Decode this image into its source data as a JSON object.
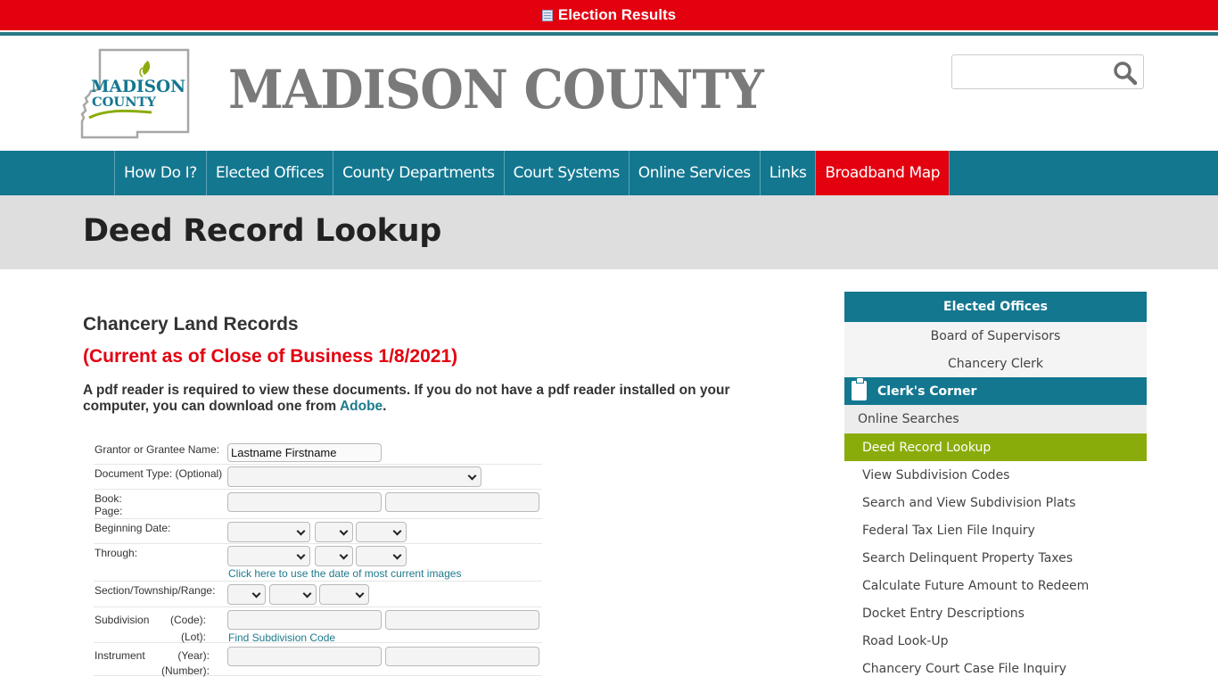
{
  "alert": {
    "label": "Election Results",
    "icon": "calendar-table-icon"
  },
  "header": {
    "logo_text_line1": "MADISON",
    "logo_text_line2": "COUNTY",
    "site_title": "MADISON COUNTY",
    "search_placeholder": "",
    "search_icon": "search-icon"
  },
  "nav": {
    "items": [
      {
        "label": "How Do I?"
      },
      {
        "label": "Elected Offices"
      },
      {
        "label": "County Departments"
      },
      {
        "label": "Court Systems"
      },
      {
        "label": "Online Services"
      },
      {
        "label": "Links"
      },
      {
        "label": "Broadband Map",
        "highlight": true
      }
    ]
  },
  "page": {
    "title": "Deed Record Lookup"
  },
  "main": {
    "heading": "Chancery Land Records",
    "current_notice": "(Current as of Close of Business 1/8/2021)",
    "note_text": "A pdf reader is required to view these documents. If you do not have a pdf reader installed on your computer, you can download one from ",
    "note_link": "Adobe",
    "note_end": "."
  },
  "form": {
    "name_label": "Grantor or Grantee Name:",
    "name_value": "Lastname Firstname",
    "doctype_label": "Document Type: (Optional)",
    "doctype_value": "",
    "book_label": "Book:",
    "page_label": "Page:",
    "book_value": "",
    "page_value": "",
    "begin_label": "Beginning Date:",
    "through_label": "Through:",
    "current_images_link": "Click here to use the date of most current images",
    "str_label": "Section/Township/Range:",
    "subdivision_label": "Subdivision",
    "code_label": "(Code):",
    "lot_label": "(Lot):",
    "find_code_link": "Find Subdivision Code",
    "instrument_label": "Instrument",
    "year_label": "(Year):",
    "number_label": "(Number):"
  },
  "sidebar": {
    "section_title": "Elected Offices",
    "sub_items": [
      "Board of Supervisors",
      "Chancery Clerk"
    ],
    "corner_title": "Clerk's Corner",
    "corner_icon": "clipboard-icon",
    "online_searches": "Online Searches",
    "active_item": "Deed Record Lookup",
    "items": [
      "View Subdivision Codes",
      "Search and View Subdivision Plats",
      "Federal Tax Lien File Inquiry",
      "Search Delinquent Property Taxes",
      "Calculate Future Amount to Redeem",
      "Docket Entry Descriptions",
      "Road Look-Up",
      "Chancery Court Case File Inquiry"
    ]
  },
  "colors": {
    "alert_red": "#e3000f",
    "nav_teal": "#137790",
    "active_green": "#8aac0b",
    "link_teal": "#1d7a8c"
  }
}
